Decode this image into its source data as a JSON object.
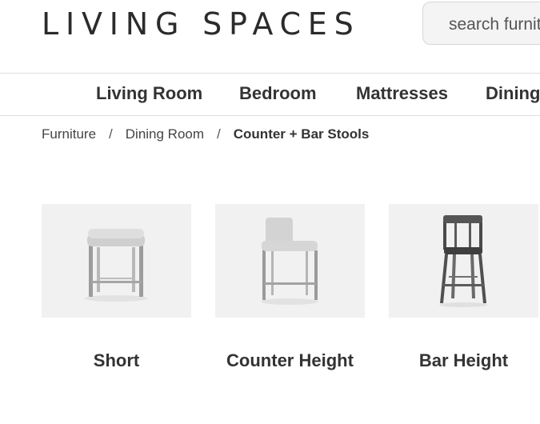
{
  "header": {
    "logo_text": "LIVING SPACES",
    "search_placeholder": "search furniture"
  },
  "nav": {
    "items": [
      {
        "label": "Living Room"
      },
      {
        "label": "Bedroom"
      },
      {
        "label": "Mattresses"
      },
      {
        "label": "Dining"
      }
    ]
  },
  "breadcrumb": {
    "items": [
      "Furniture",
      "Dining Room"
    ],
    "separator": "/",
    "current": "Counter + Bar Stools"
  },
  "categories": [
    {
      "label": "Short",
      "icon": "backless-stool-icon"
    },
    {
      "label": "Counter Height",
      "icon": "counter-stool-icon"
    },
    {
      "label": "Bar Height",
      "icon": "metal-bar-stool-icon"
    }
  ]
}
